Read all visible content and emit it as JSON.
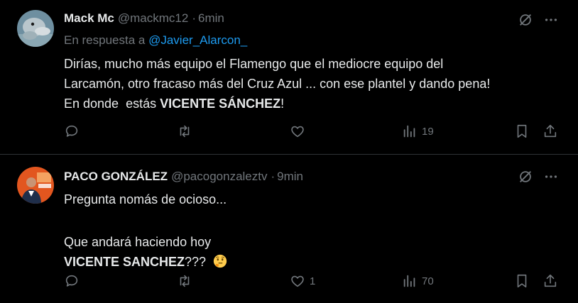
{
  "tweets": [
    {
      "name": "Mack Mc",
      "handle": "@mackmc12",
      "separator": "·",
      "time": "6min",
      "reply_prefix": "En respuesta a",
      "reply_to": "@Javier_Alarcon_",
      "line1": "Dirías, mucho más equipo el Flamengo que el mediocre equipo del",
      "line2": "Larcamón, otro fracaso más del Cruz Azul ... con ese plantel y dando pena!",
      "line3_prefix": "En donde  estás ",
      "line3_bold": "VICENTE SÁNCHEZ",
      "line3_suffix": "!",
      "views": "19",
      "avatar_icon": "dolphin-avatar"
    },
    {
      "name": "PACO GONZÁLEZ",
      "handle": "@pacogonzaleztv",
      "separator": "·",
      "time": "9min",
      "line1": "Pregunta nomás de ocioso...",
      "line2": "Que andará haciendo hoy",
      "line3_bold": "VICENTE SANCHEZ",
      "line3_suffix": "???",
      "likes": "1",
      "views": "70",
      "avatar_icon": "reporter-avatar",
      "emoji": "thinking-face-emoji"
    }
  ],
  "colors": {
    "background": "#000000",
    "text": "#e7e9ea",
    "muted": "#71767b",
    "link": "#1d9bf0",
    "divider": "#2f3336"
  }
}
